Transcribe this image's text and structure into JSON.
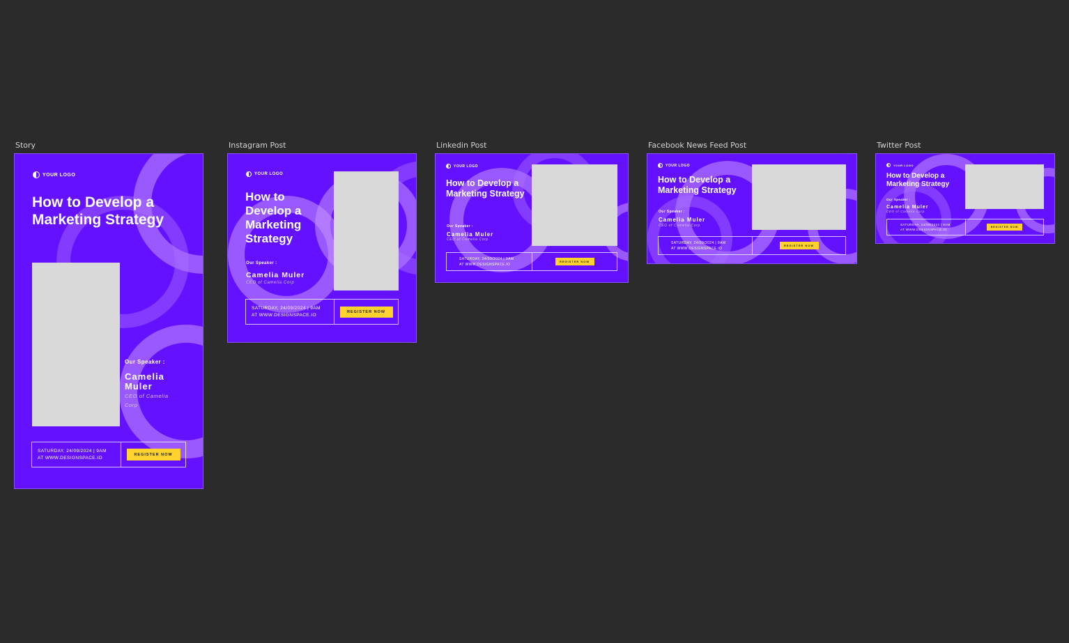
{
  "frames": {
    "story": "Story",
    "instagram": "Instagram Post",
    "linkedin": "Linkedin Post",
    "facebook": "Facebook News Feed Post",
    "twitter": "Twitter Post"
  },
  "content": {
    "logo": "YOUR LOGO",
    "headline": "How to Develop a Marketing Strategy",
    "speaker_label": "Our Speaker :",
    "speaker_name": "Camelia Muler",
    "speaker_role": "CEO of Camelia Corp",
    "date": "SATURDAY, 24/09/2024 | 9AM",
    "website": "AT WWW.DESIGNSPACE.IO",
    "cta": "REGISTER NOW"
  },
  "colors": {
    "canvas_background": "#2b2b2b",
    "artboard_purple": "#6311ff",
    "accent_yellow": "#ffd22e",
    "photo_placeholder": "#d9d9d9"
  }
}
